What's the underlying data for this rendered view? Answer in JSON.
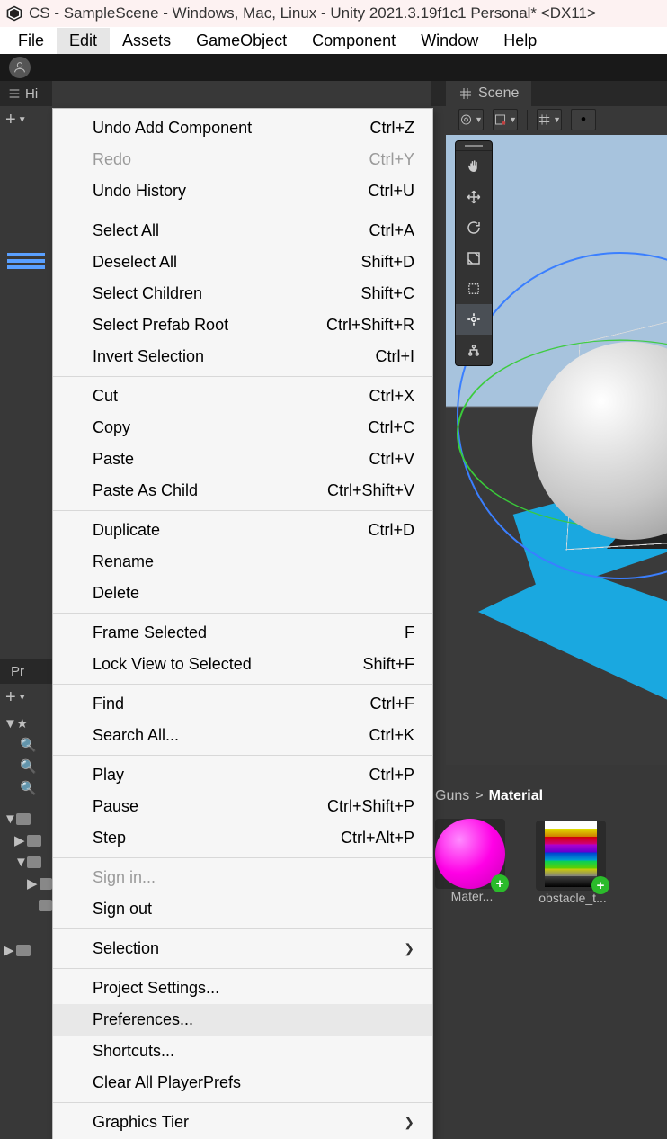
{
  "title_bar": "CS - SampleScene - Windows, Mac, Linux - Unity 2021.3.19f1c1 Personal* <DX11>",
  "menubar": {
    "file": "File",
    "edit": "Edit",
    "assets": "Assets",
    "gameobject": "GameObject",
    "component": "Component",
    "window": "Window",
    "help": "Help"
  },
  "hierarchy": {
    "tab": "Hi",
    "add": "+"
  },
  "project": {
    "tab": "Pr",
    "add": "+"
  },
  "scene": {
    "tab": "Scene"
  },
  "breadcrumb": {
    "a": "Guns",
    "sep": ">",
    "b": "Material"
  },
  "thumbs": {
    "mat": {
      "label": "Mater...",
      "badge": "+"
    },
    "tex": {
      "label": "obstacle_t...",
      "badge": "+"
    }
  },
  "edit_menu": {
    "undo": {
      "label": "Undo Add Component",
      "sc": "Ctrl+Z"
    },
    "redo": {
      "label": "Redo",
      "sc": "Ctrl+Y"
    },
    "undo_history": {
      "label": "Undo History",
      "sc": "Ctrl+U"
    },
    "select_all": {
      "label": "Select All",
      "sc": "Ctrl+A"
    },
    "deselect_all": {
      "label": "Deselect All",
      "sc": "Shift+D"
    },
    "select_children": {
      "label": "Select Children",
      "sc": "Shift+C"
    },
    "select_prefab_root": {
      "label": "Select Prefab Root",
      "sc": "Ctrl+Shift+R"
    },
    "invert_selection": {
      "label": "Invert Selection",
      "sc": "Ctrl+I"
    },
    "cut": {
      "label": "Cut",
      "sc": "Ctrl+X"
    },
    "copy": {
      "label": "Copy",
      "sc": "Ctrl+C"
    },
    "paste": {
      "label": "Paste",
      "sc": "Ctrl+V"
    },
    "paste_child": {
      "label": "Paste As Child",
      "sc": "Ctrl+Shift+V"
    },
    "duplicate": {
      "label": "Duplicate",
      "sc": "Ctrl+D"
    },
    "rename": {
      "label": "Rename",
      "sc": ""
    },
    "delete": {
      "label": "Delete",
      "sc": ""
    },
    "frame_selected": {
      "label": "Frame Selected",
      "sc": "F"
    },
    "lock_view": {
      "label": "Lock View to Selected",
      "sc": "Shift+F"
    },
    "find": {
      "label": "Find",
      "sc": "Ctrl+F"
    },
    "search_all": {
      "label": "Search All...",
      "sc": "Ctrl+K"
    },
    "play": {
      "label": "Play",
      "sc": "Ctrl+P"
    },
    "pause": {
      "label": "Pause",
      "sc": "Ctrl+Shift+P"
    },
    "step": {
      "label": "Step",
      "sc": "Ctrl+Alt+P"
    },
    "sign_in": {
      "label": "Sign in...",
      "sc": ""
    },
    "sign_out": {
      "label": "Sign out",
      "sc": ""
    },
    "selection": {
      "label": "Selection",
      "sc": ""
    },
    "project_settings": {
      "label": "Project Settings...",
      "sc": ""
    },
    "preferences": {
      "label": "Preferences...",
      "sc": ""
    },
    "shortcuts": {
      "label": "Shortcuts...",
      "sc": ""
    },
    "clear_prefs": {
      "label": "Clear All PlayerPrefs",
      "sc": ""
    },
    "graphics_tier": {
      "label": "Graphics Tier",
      "sc": ""
    }
  }
}
